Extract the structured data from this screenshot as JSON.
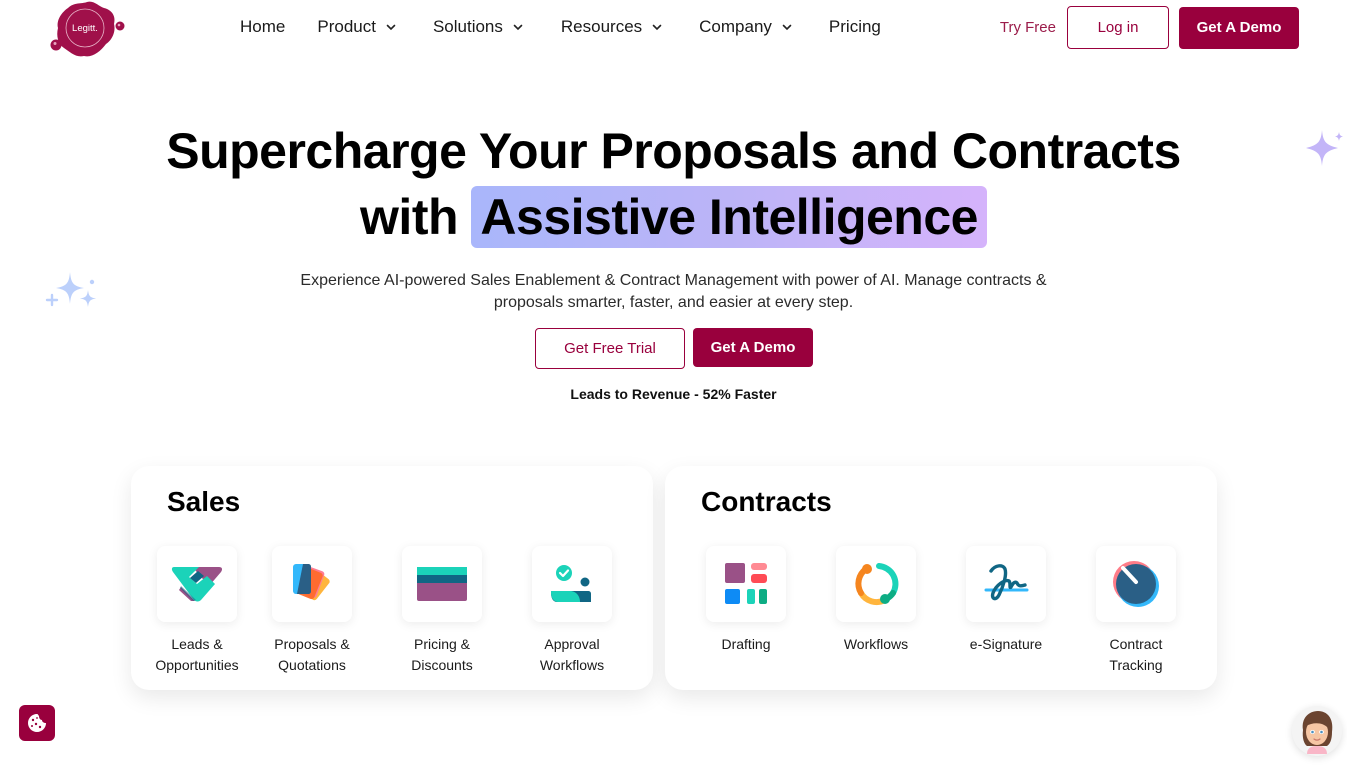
{
  "brand": {
    "name": "Legitt.",
    "primary_color": "#99003d",
    "highlight_gradient": [
      "#a9b6fb",
      "#d5b3fb"
    ]
  },
  "nav": {
    "items": [
      {
        "label": "Home",
        "has_dropdown": false
      },
      {
        "label": "Product",
        "has_dropdown": true
      },
      {
        "label": "Solutions",
        "has_dropdown": true
      },
      {
        "label": "Resources",
        "has_dropdown": true
      },
      {
        "label": "Company",
        "has_dropdown": true
      },
      {
        "label": "Pricing",
        "has_dropdown": false
      }
    ],
    "try_free": "Try Free",
    "login": "Log in",
    "demo": "Get A Demo"
  },
  "hero": {
    "title_line1": "Supercharge Your Proposals and Contracts",
    "title_line2_prefix": "with",
    "title_highlight": "Assistive Intelligence",
    "subtitle_line1": "Experience AI-powered Sales Enablement & Contract Management with power of AI. Manage contracts &",
    "subtitle_line2": "proposals smarter, faster, and easier at every step.",
    "cta_trial": "Get Free Trial",
    "cta_demo": "Get A Demo",
    "tagline": "Leads to Revenue - 52% Faster"
  },
  "sales": {
    "title": "Sales",
    "features": [
      {
        "line1": "Leads &",
        "line2": "Opportunities",
        "icon": "handshake-icon"
      },
      {
        "line1": "Proposals &",
        "line2": "Quotations",
        "icon": "documents-stack-icon"
      },
      {
        "line1": "Pricing &",
        "line2": "Discounts",
        "icon": "credit-card-icon"
      },
      {
        "line1": "Approval",
        "line2": "Workflows",
        "icon": "user-approval-icon"
      }
    ]
  },
  "contracts": {
    "title": "Contracts",
    "features": [
      {
        "line1": "Drafting",
        "line2": "",
        "icon": "layout-blocks-icon"
      },
      {
        "line1": "Workflows",
        "line2": "",
        "icon": "cycle-arrows-icon"
      },
      {
        "line1": "e-Signature",
        "line2": "",
        "icon": "signature-icon"
      },
      {
        "line1": "Contract",
        "line2": "Tracking",
        "icon": "gauge-icon"
      }
    ]
  }
}
